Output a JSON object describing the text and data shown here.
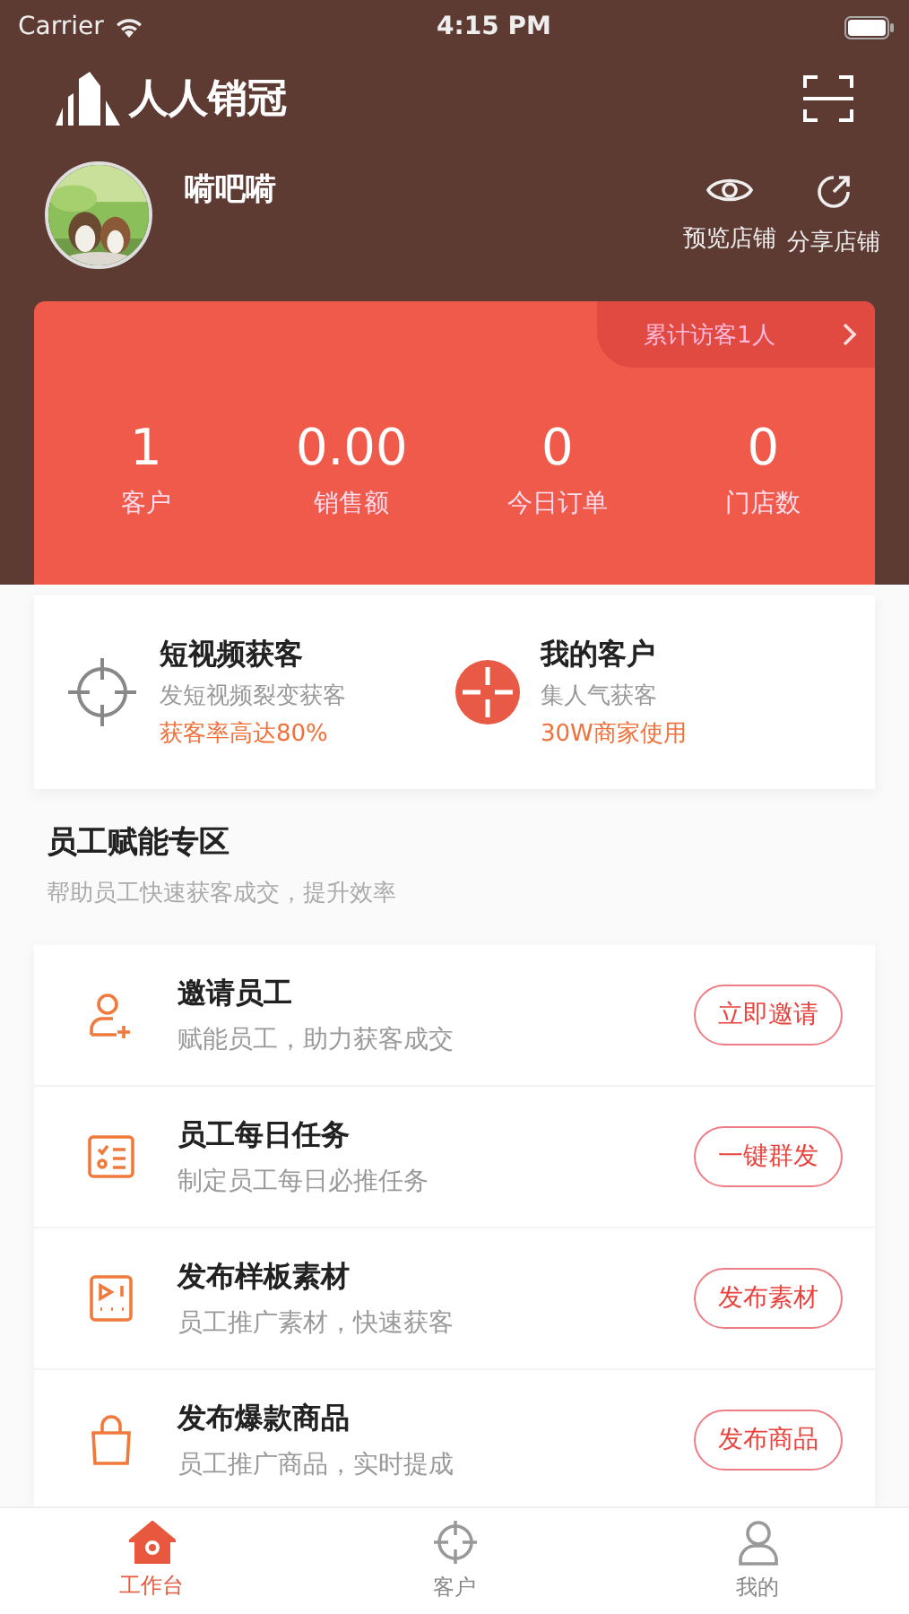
{
  "status_bar": {
    "carrier": "Carrier",
    "time": "4:15 PM"
  },
  "header": {
    "logo_text": "人人销冠",
    "user_name": "嗬吧嗬",
    "actions": [
      {
        "label": "预览店铺",
        "kind": "eye"
      },
      {
        "label": "分享店铺",
        "kind": "share"
      }
    ]
  },
  "stats_card": {
    "visitors": "累计访客1人",
    "stats": [
      {
        "value": "1",
        "label": "客户"
      },
      {
        "value": "0.00",
        "label": "销售额"
      },
      {
        "value": "0",
        "label": "今日订单"
      },
      {
        "value": "0",
        "label": "门店数"
      }
    ]
  },
  "features": [
    {
      "kind": "target",
      "title": "短视频获客",
      "subtitle": "发短视频裂变获客",
      "highlight": "获客率高达80%"
    },
    {
      "kind": "crosshair-filled",
      "title": "我的客户",
      "subtitle": "集人气获客",
      "highlight": "30W商家使用"
    }
  ],
  "section": {
    "title": "员工赋能专区",
    "subtitle": "帮助员工快速获客成交，提升效率"
  },
  "tasks": [
    {
      "kind": "user-add",
      "title": "邀请员工",
      "subtitle": "赋能员工，助力获客成交",
      "button": "立即邀请"
    },
    {
      "kind": "checklist",
      "title": "员工每日任务",
      "subtitle": "制定员工每日必推任务",
      "button": "一键群发"
    },
    {
      "kind": "media",
      "title": "发布样板素材",
      "subtitle": "员工推广素材，快速获客",
      "button": "发布素材"
    },
    {
      "kind": "bag",
      "title": "发布爆款商品",
      "subtitle": "员工推广商品，实时提成",
      "button": "发布商品"
    }
  ],
  "tab_bar": [
    {
      "label": "工作台",
      "kind": "home",
      "selected": true
    },
    {
      "label": "客户",
      "kind": "target",
      "selected": false
    },
    {
      "label": "我的",
      "kind": "person",
      "selected": false
    }
  ]
}
